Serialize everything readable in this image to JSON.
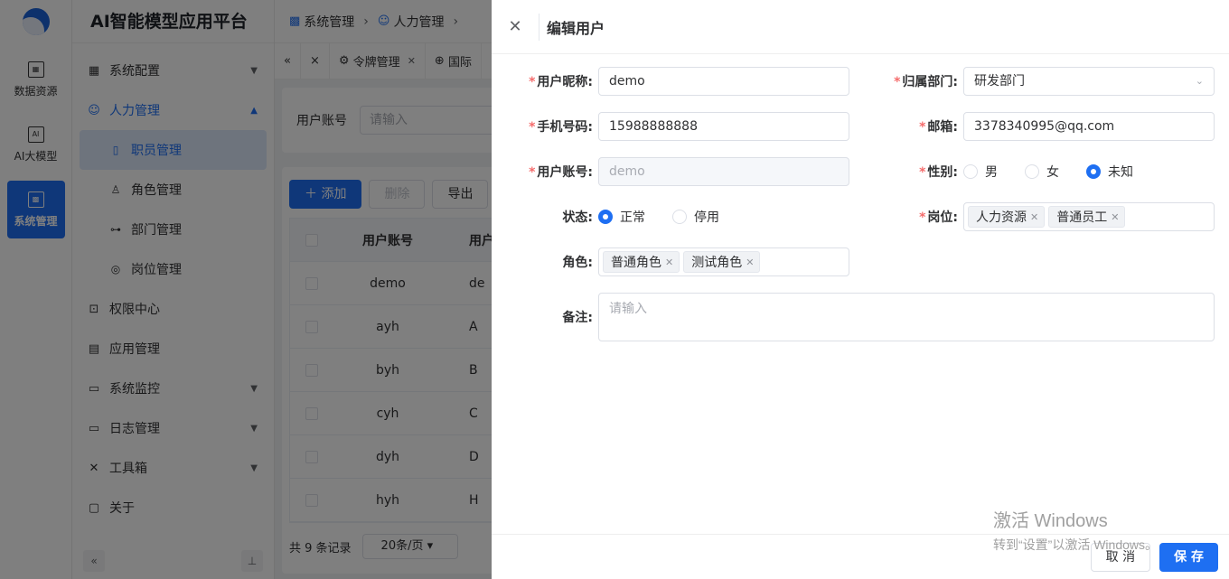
{
  "rail": {
    "items": [
      {
        "label": "数据资源",
        "icon": "data-resource-icon"
      },
      {
        "label": "AI大模型",
        "icon": "ai-model-icon"
      },
      {
        "label": "系统管理",
        "icon": "system-manage-icon",
        "active": true
      }
    ]
  },
  "sidebar": {
    "title": "AI智能模型应用平台",
    "items": [
      {
        "label": "系统配置",
        "icon": "grid-icon"
      },
      {
        "label": "人力管理",
        "icon": "users-icon",
        "open": true
      },
      {
        "label": "职员管理",
        "icon": "user-card-icon",
        "active": true
      },
      {
        "label": "角色管理",
        "icon": "user-role-icon"
      },
      {
        "label": "部门管理",
        "icon": "org-icon"
      },
      {
        "label": "岗位管理",
        "icon": "compass-icon"
      },
      {
        "label": "权限中心",
        "icon": "lock-icon"
      },
      {
        "label": "应用管理",
        "icon": "apps-icon"
      },
      {
        "label": "系统监控",
        "icon": "monitor-icon"
      },
      {
        "label": "日志管理",
        "icon": "log-icon"
      },
      {
        "label": "工具箱",
        "icon": "tools-icon"
      },
      {
        "label": "关于",
        "icon": "about-icon"
      }
    ]
  },
  "breadcrumb": {
    "items": [
      "系统管理",
      "人力管理"
    ]
  },
  "tabs": {
    "items": [
      "令牌管理",
      "国际"
    ]
  },
  "search": {
    "label": "用户账号",
    "placeholder": "请输入"
  },
  "toolbar": {
    "add": "添加",
    "delete": "删除",
    "export": "导出"
  },
  "table": {
    "headers": [
      "用户账号",
      "用户"
    ],
    "rows": [
      {
        "account": "demo",
        "name": "de"
      },
      {
        "account": "ayh",
        "name": "A"
      },
      {
        "account": "byh",
        "name": "B"
      },
      {
        "account": "cyh",
        "name": "C"
      },
      {
        "account": "dyh",
        "name": "D"
      },
      {
        "account": "hyh",
        "name": "H"
      }
    ],
    "total": "共 9 条记录",
    "page_size": "20条/页"
  },
  "drawer": {
    "title": "编辑用户",
    "fields": {
      "nickname_label": "用户昵称:",
      "nickname_value": "demo",
      "dept_label": "归属部门:",
      "dept_value": "研发部门",
      "phone_label": "手机号码:",
      "phone_value": "15988888888",
      "email_label": "邮箱:",
      "email_value": "3378340995@qq.com",
      "account_label": "用户账号:",
      "account_value": "demo",
      "gender_label": "性别:",
      "gender_options": [
        "男",
        "女",
        "未知"
      ],
      "gender_selected": "未知",
      "status_label": "状态:",
      "status_options": [
        "正常",
        "停用"
      ],
      "status_selected": "正常",
      "post_label": "岗位:",
      "posts": [
        "人力资源",
        "普通员工"
      ],
      "role_label": "角色:",
      "roles": [
        "普通角色",
        "测试角色"
      ],
      "remark_label": "备注:",
      "remark_placeholder": "请输入"
    },
    "cancel": "取 消",
    "save": "保 存"
  },
  "watermark": {
    "line1": "激活 Windows",
    "line2": "转到“设置”以激活 Windows。"
  },
  "colors": {
    "primary": "#1e6ff2",
    "required": "#f56c6c"
  }
}
